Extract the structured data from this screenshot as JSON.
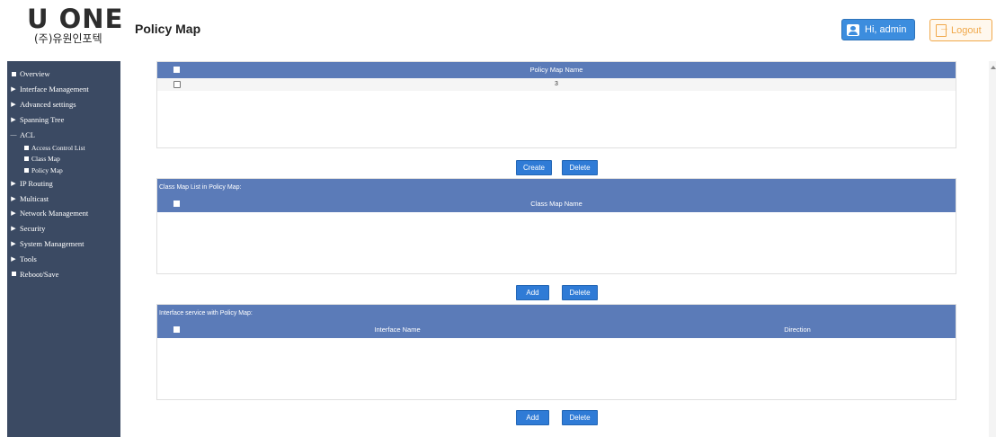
{
  "header": {
    "logo_main": "U ONE",
    "logo_sub": "(주)유원인포텍",
    "page_title": "Policy Map",
    "user_button": "Hi, admin",
    "logout_button": "Logout"
  },
  "sidebar": {
    "items": [
      {
        "label": "Overview",
        "marker": "square"
      },
      {
        "label": "Interface Management",
        "marker": "arrow"
      },
      {
        "label": "Advanced settings",
        "marker": "arrow"
      },
      {
        "label": "Spanning Tree",
        "marker": "arrow"
      },
      {
        "label": "ACL",
        "marker": "dash"
      }
    ],
    "acl_subitems": [
      "Access Control List",
      "Class Map",
      "Policy Map"
    ],
    "items_after": [
      {
        "label": "IP Routing",
        "marker": "arrow"
      },
      {
        "label": "Multicast",
        "marker": "arrow"
      },
      {
        "label": "Network Management",
        "marker": "arrow"
      },
      {
        "label": "Security",
        "marker": "arrow"
      },
      {
        "label": "System Management",
        "marker": "arrow"
      },
      {
        "label": "Tools",
        "marker": "arrow"
      },
      {
        "label": "Reboot/Save",
        "marker": "square"
      }
    ]
  },
  "policy_table": {
    "column": "Policy Map Name",
    "rows": [
      {
        "name": "3"
      }
    ]
  },
  "policy_buttons": {
    "create": "Create",
    "delete": "Delete"
  },
  "class_map_section": {
    "caption": "Class Map List in Policy Map:",
    "column": "Class Map Name",
    "add": "Add",
    "delete": "Delete"
  },
  "interface_section": {
    "caption": "Interface service with Policy Map:",
    "col_interface": "Interface Name",
    "col_direction": "Direction",
    "add": "Add",
    "delete": "Delete"
  },
  "colors": {
    "sidebar_bg": "#3b4a63",
    "table_header": "#5b7bb8",
    "button": "#2f7bd6",
    "logout": "#f0a84a"
  }
}
